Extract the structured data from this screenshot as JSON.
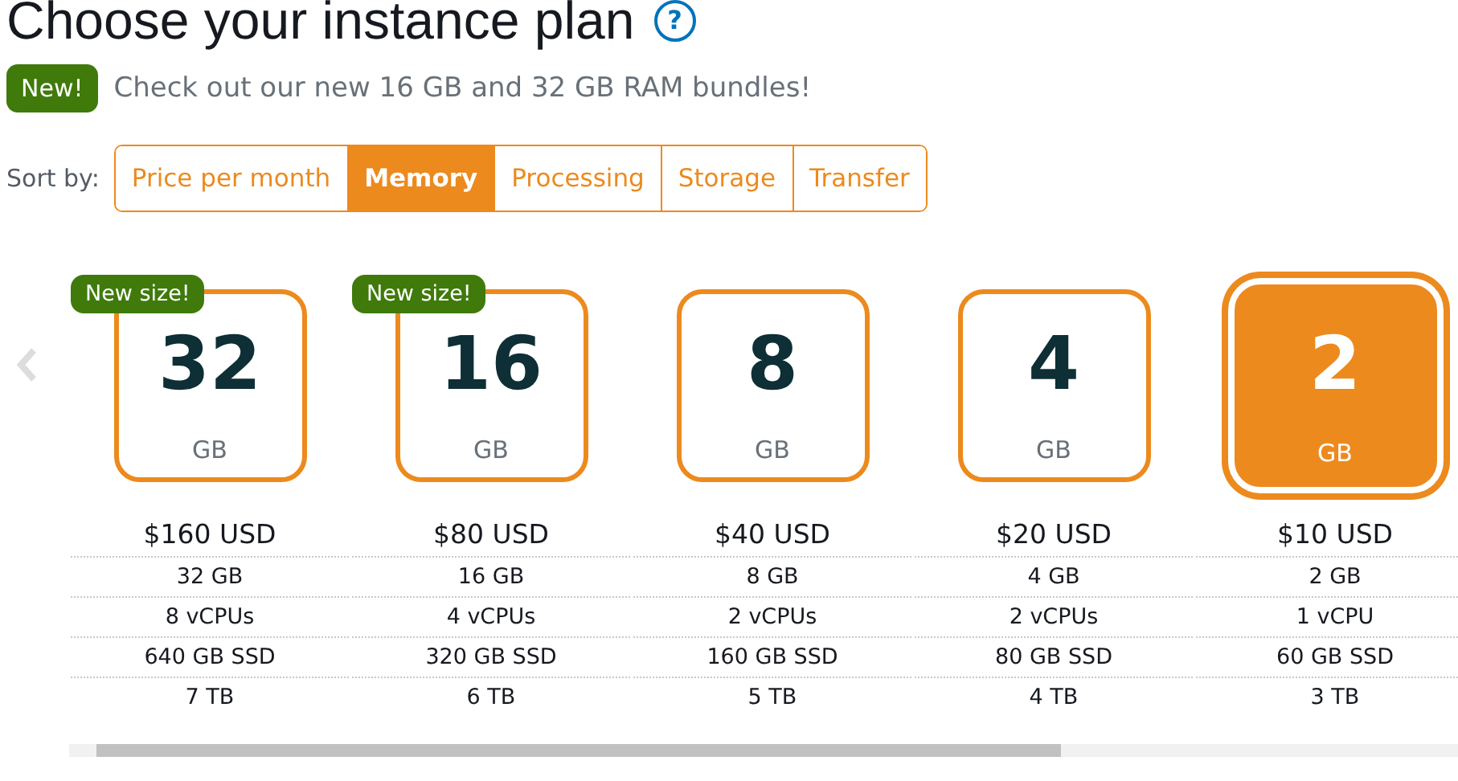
{
  "title": "Choose your instance plan",
  "help": "?",
  "notice": {
    "badge": "New!",
    "text": "Check out our new 16 GB and 32 GB RAM bundles!"
  },
  "sort": {
    "label": "Sort by:",
    "options": [
      {
        "label": "Price per month",
        "selected": false
      },
      {
        "label": "Memory",
        "selected": true
      },
      {
        "label": "Processing",
        "selected": false
      },
      {
        "label": "Storage",
        "selected": false
      },
      {
        "label": "Transfer",
        "selected": false
      }
    ]
  },
  "plans": [
    {
      "size": "32",
      "unit": "GB",
      "badge": "New size!",
      "selected": false,
      "price": "$160 USD",
      "specs": [
        "32 GB",
        "8 vCPUs",
        "640 GB SSD",
        "7 TB"
      ]
    },
    {
      "size": "16",
      "unit": "GB",
      "badge": "New size!",
      "selected": false,
      "price": "$80 USD",
      "specs": [
        "16 GB",
        "4 vCPUs",
        "320 GB SSD",
        "6 TB"
      ]
    },
    {
      "size": "8",
      "unit": "GB",
      "selected": false,
      "price": "$40 USD",
      "specs": [
        "8 GB",
        "2 vCPUs",
        "160 GB SSD",
        "5 TB"
      ]
    },
    {
      "size": "4",
      "unit": "GB",
      "selected": false,
      "price": "$20 USD",
      "specs": [
        "4 GB",
        "2 vCPUs",
        "80 GB SSD",
        "4 TB"
      ]
    },
    {
      "size": "2",
      "unit": "GB",
      "selected": true,
      "price": "$10 USD",
      "specs": [
        "2 GB",
        "1 vCPU",
        "60 GB SSD",
        "3 TB"
      ]
    }
  ]
}
